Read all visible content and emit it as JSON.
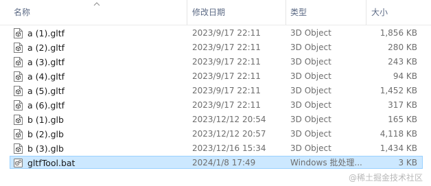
{
  "columns": {
    "name": "名称",
    "date": "修改日期",
    "type": "类型",
    "size": "大小"
  },
  "files": [
    {
      "name": "a (1).gltf",
      "date": "2023/9/17 22:11",
      "type": "3D Object",
      "size": "1,856 KB",
      "icon": "3d-object-icon"
    },
    {
      "name": "a (2).gltf",
      "date": "2023/9/17 22:11",
      "type": "3D Object",
      "size": "280 KB",
      "icon": "3d-object-icon"
    },
    {
      "name": "a (3).gltf",
      "date": "2023/9/17 22:11",
      "type": "3D Object",
      "size": "243 KB",
      "icon": "3d-object-icon"
    },
    {
      "name": "a (4).gltf",
      "date": "2023/9/17 22:11",
      "type": "3D Object",
      "size": "94 KB",
      "icon": "3d-object-icon"
    },
    {
      "name": "a (5).gltf",
      "date": "2023/9/17 22:11",
      "type": "3D Object",
      "size": "1,452 KB",
      "icon": "3d-object-icon"
    },
    {
      "name": "a (6).gltf",
      "date": "2023/9/17 22:11",
      "type": "3D Object",
      "size": "317 KB",
      "icon": "3d-object-icon"
    },
    {
      "name": "b (1).glb",
      "date": "2023/12/12 20:54",
      "type": "3D Object",
      "size": "165 KB",
      "icon": "3d-object-icon"
    },
    {
      "name": "b (2).glb",
      "date": "2023/12/12 20:57",
      "type": "3D Object",
      "size": "4,118 KB",
      "icon": "3d-object-icon"
    },
    {
      "name": "b (3).glb",
      "date": "2023/12/16 15:34",
      "type": "3D Object",
      "size": "1,434 KB",
      "icon": "3d-object-icon"
    },
    {
      "name": "gltfTool.bat",
      "date": "2024/1/8 17:49",
      "type": "Windows 批处理...",
      "size": "3 KB",
      "icon": "batch-file-icon",
      "selected": true
    }
  ],
  "watermark": "@稀土掘金技术社区",
  "colors": {
    "header_text": "#5c6a85",
    "selection_bg": "#cce8ff",
    "selection_border": "#99d1ff"
  }
}
